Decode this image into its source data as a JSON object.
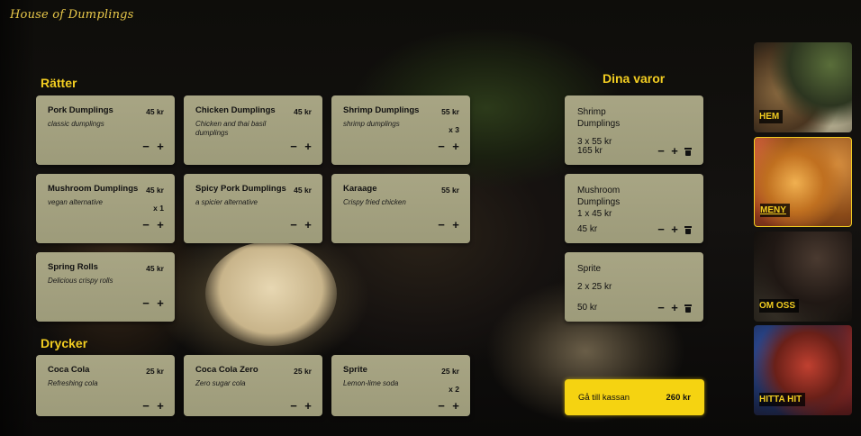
{
  "logo": "House of Dumplings",
  "sections": {
    "food_title": "Rätter",
    "drinks_title": "Drycker",
    "cart_title": "Dina varor"
  },
  "controls": {
    "minus": "−",
    "plus": "+"
  },
  "food": [
    {
      "name": "Pork Dumplings",
      "price": "45 kr",
      "desc": "classic dumplings",
      "qty": ""
    },
    {
      "name": "Chicken Dumplings",
      "price": "45 kr",
      "desc": "Chicken and thai basil dumplings",
      "qty": ""
    },
    {
      "name": "Shrimp Dumplings",
      "price": "55 kr",
      "desc": "shrimp dumplings",
      "qty": "x 3"
    },
    {
      "name": "Mushroom Dumplings",
      "price": "45 kr",
      "desc": "vegan alternative",
      "qty": "x 1"
    },
    {
      "name": "Spicy Pork Dumplings",
      "price": "45 kr",
      "desc": "a spicier alternative",
      "qty": ""
    },
    {
      "name": "Karaage",
      "price": "55 kr",
      "desc": "Crispy fried chicken",
      "qty": ""
    },
    {
      "name": "Spring Rolls",
      "price": "45 kr",
      "desc": "Delicious crispy rolls",
      "qty": ""
    }
  ],
  "drinks": [
    {
      "name": "Coca Cola",
      "price": "25 kr",
      "desc": "Refreshing cola",
      "qty": ""
    },
    {
      "name": "Coca Cola Zero",
      "price": "25 kr",
      "desc": "Zero sugar cola",
      "qty": ""
    },
    {
      "name": "Sprite",
      "price": "25 kr",
      "desc": "Lemon-lime soda",
      "qty": "x 2"
    }
  ],
  "cart": [
    {
      "name": "Shrimp Dumplings",
      "qty_line": "3 x 55 kr",
      "total": "165 kr"
    },
    {
      "name": "Mushroom Dumplings",
      "qty_line": "1 x 45 kr",
      "total": "45 kr"
    },
    {
      "name": "Sprite",
      "qty_line": "2 x 25 kr",
      "total": "50 kr"
    }
  ],
  "checkout": {
    "label": "Gå till kassan",
    "total": "260 kr"
  },
  "nav": [
    {
      "label": "HEM",
      "active": false
    },
    {
      "label": "MENY",
      "active": true
    },
    {
      "label": "OM OSS",
      "active": false
    },
    {
      "label": "HITTA HIT",
      "active": false
    }
  ],
  "colors": {
    "accent": "#f2cd21",
    "card": "#a8a584",
    "checkout": "#f5d311"
  }
}
